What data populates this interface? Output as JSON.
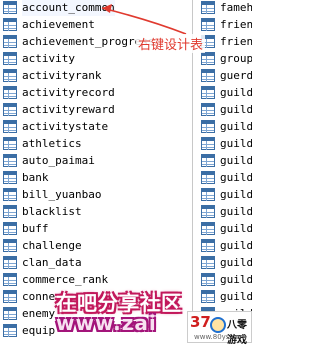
{
  "left_tables": [
    "account_common",
    "achievement",
    "achievement_progress",
    "activity",
    "activityrank",
    "activityrecord",
    "activityreward",
    "activitystate",
    "athletics",
    "auto_paimai",
    "bank",
    "bill_yuanbao",
    "blacklist",
    "buff",
    "challenge",
    "clan_data",
    "commerce_rank",
    "conne",
    "enemy",
    "equip"
  ],
  "right_tables": [
    "famehal",
    "friend",
    "friend",
    "group_",
    "guerdo",
    "guild",
    "guild",
    "guild_",
    "guild_",
    "guild_",
    "guild_",
    "guild_",
    "guild_",
    "guild_",
    "guild_",
    "guild_",
    "guild_",
    "guild_",
    "guild_"
  ],
  "annotation": {
    "text": "右键设计表",
    "color": "#e03a2f"
  },
  "watermark": {
    "line1": "在吧分享社区",
    "line2": "www.zai"
  },
  "logo": {
    "number": "37",
    "text": "八零游戏",
    "url": "www.80ys.com"
  },
  "colors": {
    "icon_blue": "#3b6ea5",
    "annotation_red": "#e03a2f",
    "watermark_pink": "#c2185b"
  }
}
